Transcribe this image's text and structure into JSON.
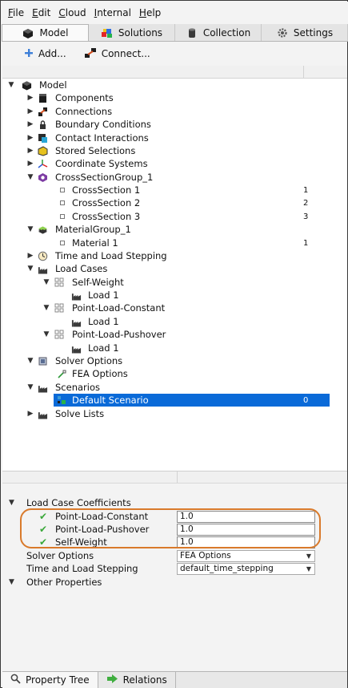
{
  "menu": [
    "File",
    "Edit",
    "Cloud",
    "Internal",
    "Help"
  ],
  "menu_mnemonics": [
    "F",
    "E",
    "C",
    "I",
    "H"
  ],
  "tabs": [
    {
      "label": "Model",
      "icon": "model-cube-icon",
      "active": true
    },
    {
      "label": "Solutions",
      "icon": "solutions-cubes-icon",
      "active": false
    },
    {
      "label": "Collection",
      "icon": "collection-cylinder-icon",
      "active": false
    },
    {
      "label": "Settings",
      "icon": "gear-icon",
      "active": false
    }
  ],
  "toolbar": {
    "add_label": "Add...",
    "connect_label": "Connect..."
  },
  "tree": [
    {
      "label": "Model",
      "icon": "model-cube-icon",
      "expanded": true,
      "num": ""
    },
    {
      "label": "Components",
      "icon": "component-block-icon",
      "expanded": false,
      "num": ""
    },
    {
      "label": "Connections",
      "icon": "connection-icon",
      "expanded": false,
      "num": ""
    },
    {
      "label": "Boundary Conditions",
      "icon": "lock-icon",
      "expanded": false,
      "num": ""
    },
    {
      "label": "Contact Interactions",
      "icon": "contact-icon",
      "expanded": false,
      "num": ""
    },
    {
      "label": "Stored Selections",
      "icon": "selection-icon",
      "expanded": false,
      "num": ""
    },
    {
      "label": "Coordinate Systems",
      "icon": "axes-icon",
      "expanded": false,
      "num": ""
    },
    {
      "label": "CrossSectionGroup_1",
      "icon": "hexagon-icon",
      "expanded": true,
      "num": ""
    },
    {
      "label": "CrossSection 1",
      "icon": "small-square-icon",
      "expanded": null,
      "num": "1"
    },
    {
      "label": "CrossSection 2",
      "icon": "small-square-icon",
      "expanded": null,
      "num": "2"
    },
    {
      "label": "CrossSection 3",
      "icon": "small-square-icon",
      "expanded": null,
      "num": "3"
    },
    {
      "label": "MaterialGroup_1",
      "icon": "material-layers-icon",
      "expanded": true,
      "num": ""
    },
    {
      "label": "Material 1",
      "icon": "small-square-icon",
      "expanded": null,
      "num": "1"
    },
    {
      "label": "Time and Load Stepping",
      "icon": "clock-icon",
      "expanded": false,
      "num": ""
    },
    {
      "label": "Load Cases",
      "icon": "factory-icon",
      "expanded": true,
      "num": ""
    },
    {
      "label": "Self-Weight",
      "icon": "grid-icon",
      "expanded": true,
      "num": ""
    },
    {
      "label": "Load 1",
      "icon": "factory-icon",
      "expanded": null,
      "num": ""
    },
    {
      "label": "Point-Load-Constant",
      "icon": "grid-icon",
      "expanded": true,
      "num": ""
    },
    {
      "label": "Load 1",
      "icon": "factory-icon",
      "expanded": null,
      "num": ""
    },
    {
      "label": "Point-Load-Pushover",
      "icon": "grid-icon",
      "expanded": true,
      "num": ""
    },
    {
      "label": "Load 1",
      "icon": "factory-icon",
      "expanded": null,
      "num": ""
    },
    {
      "label": "Solver Options",
      "icon": "solver-icon",
      "expanded": true,
      "num": ""
    },
    {
      "label": "FEA Options",
      "icon": "fea-options-icon",
      "expanded": null,
      "num": ""
    },
    {
      "label": "Scenarios",
      "icon": "factory-icon",
      "expanded": true,
      "num": ""
    },
    {
      "label": "Default Scenario",
      "icon": "scenario-icon",
      "expanded": null,
      "num": "0",
      "selected": true
    },
    {
      "label": "Solve Lists",
      "icon": "factory-icon",
      "expanded": false,
      "num": ""
    }
  ],
  "properties": {
    "section_title": "Load Case Coefficients",
    "coefficients": [
      {
        "label": "Point-Load-Constant",
        "value": "1.0"
      },
      {
        "label": "Point-Load-Pushover",
        "value": "1.0"
      },
      {
        "label": "Self-Weight",
        "value": "1.0"
      }
    ],
    "solver_options_label": "Solver Options",
    "solver_options_value": "FEA Options",
    "time_stepping_label": "Time and Load Stepping",
    "time_stepping_value": "default_time_stepping",
    "other_properties": "Other Properties"
  },
  "bottom_tabs": [
    {
      "label": "Property Tree",
      "icon": "search-icon",
      "active": true
    },
    {
      "label": "Relations",
      "icon": "arrow-right-icon",
      "active": false
    }
  ],
  "colors": {
    "selection": "#0a6ad8",
    "highlight_oval": "#d97a2b",
    "check": "#3aa83a"
  }
}
